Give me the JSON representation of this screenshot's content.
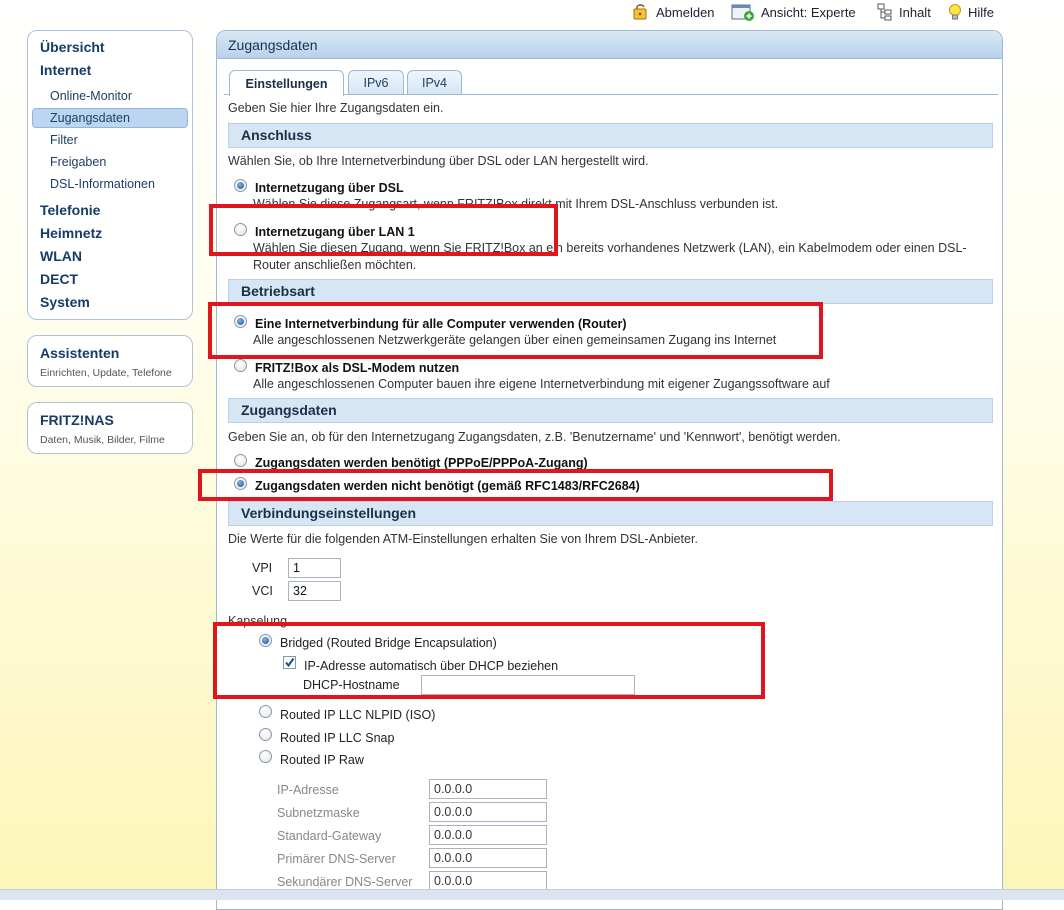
{
  "topnav": {
    "logout": "Abmelden",
    "view": "Ansicht: Experte",
    "contents": "Inhalt",
    "help": "Hilfe"
  },
  "sidebar": {
    "main_items": [
      "Übersicht",
      "Internet"
    ],
    "internet_sub": [
      "Online-Monitor",
      "Zugangsdaten",
      "Filter",
      "Freigaben",
      "DSL-Informationen"
    ],
    "more_items": [
      "Telefonie",
      "Heimnetz",
      "WLAN",
      "DECT",
      "System"
    ],
    "assistants": {
      "title": "Assistenten",
      "subtitle": "Einrichten, Update, Telefone"
    },
    "nas": {
      "title": "FRITZ!NAS",
      "subtitle": "Daten, Musik, Bilder, Filme"
    }
  },
  "panel": {
    "title": "Zugangsdaten",
    "tabs": [
      "Einstellungen",
      "IPv6",
      "IPv4"
    ],
    "active_tab": "Einstellungen",
    "intro": "Geben Sie hier Ihre Zugangsdaten ein."
  },
  "anschluss": {
    "title": "Anschluss",
    "hint": "Wählen Sie, ob Ihre Internetverbindung über DSL oder LAN hergestellt wird.",
    "dsl_label": "Internetzugang über DSL",
    "dsl_desc": "Wählen Sie diese Zugangsart, wenn FRITZ!Box direkt mit Ihrem DSL-Anschluss verbunden ist.",
    "lan_label": "Internetzugang über LAN 1",
    "lan_desc": "Wählen Sie diesen Zugang, wenn Sie FRITZ!Box an ein bereits vorhandenes Netzwerk (LAN), ein Kabelmodem oder einen DSL-Router anschließen möchten.",
    "selected": "dsl"
  },
  "betriebsart": {
    "title": "Betriebsart",
    "router_label": "Eine Internetverbindung für alle Computer verwenden (Router)",
    "router_desc": "Alle angeschlossenen Netzwerkgeräte gelangen über einen gemeinsamen Zugang ins Internet",
    "modem_label": "FRITZ!Box als DSL-Modem nutzen",
    "modem_desc": "Alle angeschlossenen Computer bauen ihre eigene Internetverbindung mit eigener Zugangssoftware auf",
    "selected": "router"
  },
  "zugangsdaten": {
    "title": "Zugangsdaten",
    "hint": "Geben Sie an, ob für den Internetzugang Zugangsdaten, z.B. 'Benutzername' und 'Kennwort', benötigt werden.",
    "needed_label": "Zugangsdaten werden benötigt (PPPoE/PPPoA-Zugang)",
    "not_needed_label": "Zugangsdaten werden nicht benötigt (gemäß RFC1483/RFC2684)",
    "selected": "not_needed"
  },
  "verbindung": {
    "title": "Verbindungseinstellungen",
    "hint": "Die Werte für die folgenden ATM-Einstellungen erhalten Sie von Ihrem DSL-Anbieter.",
    "vpi_label": "VPI",
    "vpi_value": "1",
    "vci_label": "VCI",
    "vci_value": "32",
    "kapselung_label": "Kapselung",
    "bridged_label": "Bridged (Routed Bridge Encapsulation)",
    "dhcp_label": "IP-Adresse automatisch über DHCP beziehen",
    "dhcp_checked": true,
    "hostname_label": "DHCP-Hostname",
    "hostname_value": "",
    "nlpid_label": "Routed IP LLC NLPID (ISO)",
    "snap_label": "Routed IP LLC Snap",
    "raw_label": "Routed IP Raw",
    "selected_encapsulation": "bridged",
    "ip_fields": [
      {
        "label": "IP-Adresse",
        "value": "0.0.0.0"
      },
      {
        "label": "Subnetzmaske",
        "value": "0.0.0.0"
      },
      {
        "label": "Standard-Gateway",
        "value": "0.0.0.0"
      },
      {
        "label": "Primärer DNS-Server",
        "value": "0.0.0.0"
      },
      {
        "label": "Sekundärer DNS-Server",
        "value": "0.0.0.0"
      }
    ]
  },
  "colors": {
    "annotation_red": "#e0161c",
    "section_blue": "#d6e6f5",
    "nav_text": "#163c66"
  }
}
